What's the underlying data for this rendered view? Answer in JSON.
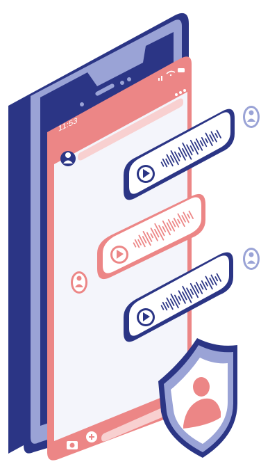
{
  "status_bar": {
    "time": "11:53"
  },
  "colors": {
    "navy": "#2b3585",
    "lavender": "#9aa3d6",
    "coral": "#ec8686",
    "coral_light": "#f3b3b3",
    "screen": "#f4f5fb",
    "white": "#ffffff"
  },
  "icons": {
    "avatar": "user-icon",
    "play": "play-icon",
    "camera": "camera-icon",
    "add": "plus-icon",
    "shield": "shield-icon",
    "signal": "signal-icon",
    "wifi": "wifi-icon",
    "battery": "battery-icon",
    "menu": "more-dots-icon"
  },
  "messages": [
    {
      "type": "voice",
      "sender": "other",
      "color": "navy"
    },
    {
      "type": "voice",
      "sender": "me",
      "color": "coral"
    },
    {
      "type": "voice",
      "sender": "other",
      "color": "navy"
    }
  ]
}
